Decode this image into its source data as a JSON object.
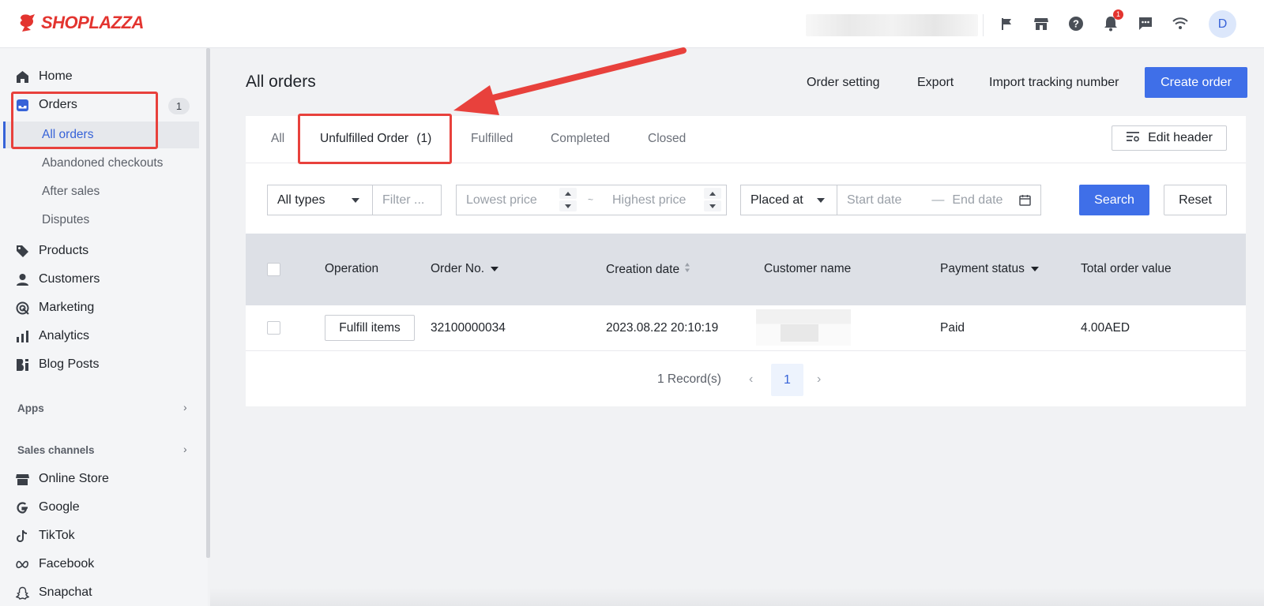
{
  "brand": {
    "name": "SHOPLAZZA",
    "color": "#e3342f"
  },
  "topbar": {
    "icons": [
      "flag-icon",
      "store-icon",
      "help-icon",
      "bell-icon",
      "chat-icon",
      "wifi-icon"
    ],
    "notification_count": "1",
    "avatar_initial": "D"
  },
  "sidebar": {
    "home": "Home",
    "orders": "Orders",
    "orders_count": "1",
    "orders_sub": [
      "All orders",
      "Abandoned checkouts",
      "After sales",
      "Disputes"
    ],
    "products": "Products",
    "customers": "Customers",
    "marketing": "Marketing",
    "analytics": "Analytics",
    "blog_posts": "Blog Posts",
    "apps_label": "Apps",
    "sales_channels_label": "Sales channels",
    "channels": [
      "Online Store",
      "Google",
      "TikTok",
      "Facebook",
      "Snapchat"
    ]
  },
  "header": {
    "title": "All orders",
    "order_setting": "Order setting",
    "export": "Export",
    "import_tracking": "Import tracking number",
    "create_order": "Create order"
  },
  "tabs": {
    "all": "All",
    "unfulfilled": "Unfulfilled Order",
    "unfulfilled_count": "(1)",
    "fulfilled": "Fulfilled",
    "completed": "Completed",
    "closed": "Closed",
    "edit_header": "Edit header"
  },
  "filters": {
    "type_value": "All types",
    "filter_placeholder": "Filter ...",
    "lowest_price_placeholder": "Lowest price",
    "range_separator": "~",
    "highest_price_placeholder": "Highest price",
    "date_field_value": "Placed at",
    "start_date_placeholder": "Start date",
    "date_separator": "—",
    "end_date_placeholder": "End date",
    "search": "Search",
    "reset": "Reset"
  },
  "table": {
    "columns": [
      "Operation",
      "Order No.",
      "Creation date",
      "Customer name",
      "Payment status",
      "Total order value"
    ],
    "rows": [
      {
        "operation": "Fulfill items",
        "order_no": "32100000034",
        "creation_date": "2023.08.22 20:10:19",
        "customer_name": "",
        "payment_status": "Paid",
        "total": "4.00AED"
      }
    ]
  },
  "pagination": {
    "records": "1 Record(s)",
    "current_page": "1"
  },
  "colors": {
    "primary": "#3f6fe8",
    "highlight": "#e8413c",
    "active_text": "#3763d8"
  }
}
